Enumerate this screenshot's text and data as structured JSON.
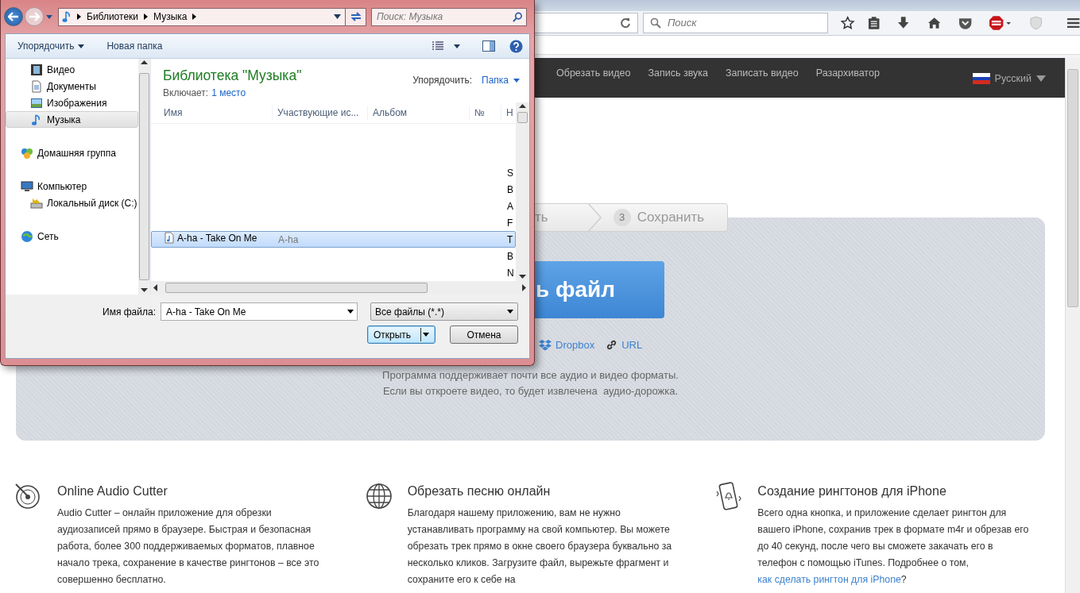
{
  "browser": {
    "search_placeholder": "Поиск"
  },
  "site_nav": {
    "items": [
      "Обрезать видео",
      "Запись звука",
      "Записать видео",
      "Разархиватор"
    ],
    "language": "Русский"
  },
  "steps": [
    {
      "label": "ть"
    },
    {
      "number": "3",
      "label": "Сохранить"
    }
  ],
  "upload": {
    "button": "ь файл",
    "sources": [
      {
        "kind": "dropbox",
        "label": "Dropbox"
      },
      {
        "kind": "link",
        "label": "URL"
      }
    ],
    "note": [
      "Программа поддерживает почти все аудио и видео форматы.",
      "Если вы откроете видео, то будет извлечена  аудио-дорожка."
    ]
  },
  "features": [
    {
      "kind": "disc",
      "title": "Online Audio Cutter",
      "text": "Audio Cutter – онлайн приложение для обрезки аудиозаписей прямо в браузере. Быстрая и безопасная работа, более 300 поддерживаемых форматов, плавное начало трека, сохранение в качестве рингтонов – все это совершенно бесплатно."
    },
    {
      "kind": "globe",
      "title": "Обрезать песню онлайн",
      "text": "Благодаря нашему приложению, вам не нужно устанавливать программу на свой компьютер. Вы можете обрезать трек прямо в окне своего браузера буквально за несколько кликов. Загрузите файл, вырежьте фрагмент и сохраните его к себе на"
    },
    {
      "kind": "phone",
      "title": "Создание рингтонов для iPhone",
      "text": "Всего одна кнопка, и приложение сделает рингтон для вашего iPhone, сохранив трек в формате m4r и обрезав его до 40 секунд, после чего вы сможете закачать его в телефон с помощью iTunes. Подробнее о том, ",
      "link": "как сделать рингтон для iPhone",
      "after": "?"
    }
  ],
  "dialog": {
    "breadcrumb": [
      "Библиотеки",
      "Музыка"
    ],
    "search_placeholder": "Поиск: Музыка",
    "toolbar": [
      {
        "label": "Упорядочить",
        "dropdown": true
      },
      {
        "label": "Новая папка",
        "dropdown": false
      }
    ],
    "nav_library_items": [
      {
        "kind": "video",
        "label": "Видео",
        "selected": false
      },
      {
        "kind": "docs",
        "label": "Документы",
        "selected": false
      },
      {
        "kind": "images",
        "label": "Изображения",
        "selected": false
      },
      {
        "kind": "music",
        "label": "Музыка",
        "selected": true
      }
    ],
    "nav": [
      {
        "kind": "homegroup",
        "label": "Домашняя группа",
        "selected": false
      },
      {
        "kind": "computer",
        "label": "Компьютер",
        "selected": false,
        "children": [
          {
            "kind": "disk",
            "label": "Локальный диск (C:)",
            "selected": false
          }
        ]
      },
      {
        "kind": "network",
        "label": "Сеть",
        "selected": false
      }
    ],
    "library": {
      "title": "Библиотека \"Музыка\"",
      "includes_label": "Включает:",
      "includes_link": "1 место",
      "arrange_label": "Упорядочить:",
      "arrange_value": "Папка"
    },
    "columns": [
      "Имя",
      "Участвующие ис...",
      "Альбом",
      "№",
      "Н"
    ],
    "rows": [
      {
        "column_5": "S",
        "selected": false
      },
      {
        "column_5": "B",
        "selected": false
      },
      {
        "column_5": "A",
        "selected": false
      },
      {
        "column_5": "F",
        "selected": false
      },
      {
        "name": "A-ha - Take On Me",
        "artist": "A-ha",
        "column_5": "T",
        "selected": true
      },
      {
        "column_5": "B",
        "selected": false
      },
      {
        "column_5": "N",
        "selected": false
      }
    ],
    "file_name_label": "Имя файла:",
    "file_name": "A-ha - Take On Me",
    "file_type": "Все файлы (*.*)",
    "buttons": [
      {
        "label": "Открыть",
        "default": true
      },
      {
        "label": "Отмена",
        "default": false
      }
    ]
  }
}
